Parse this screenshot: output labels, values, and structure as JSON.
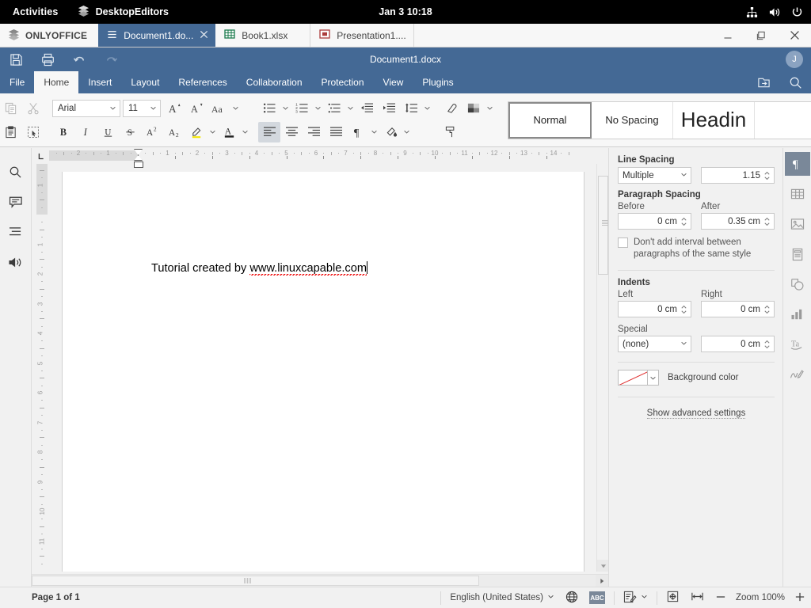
{
  "gnome": {
    "activities": "Activities",
    "app_name": "DesktopEditors",
    "app_icon": "desktopeditors-icon",
    "clock": "Jan 3  10:18",
    "tray": [
      "network-icon",
      "volume-icon",
      "power-icon"
    ]
  },
  "tabstrip": {
    "brand": "ONLYOFFICE",
    "brand_icon": "onlyoffice-logo-icon",
    "tabs": [
      {
        "label": "Document1.do...",
        "icon": "document-menu-icon",
        "active": true,
        "closable": true
      },
      {
        "label": "Book1.xlsx",
        "icon": "spreadsheet-icon",
        "active": false,
        "closable": false
      },
      {
        "label": "Presentation1....",
        "icon": "presentation-icon",
        "active": false,
        "closable": false
      }
    ],
    "window_controls": [
      "minimize-icon",
      "maximize-icon",
      "close-icon"
    ]
  },
  "header": {
    "title": "Document1.docx",
    "avatar_initial": "J",
    "quick_access": [
      "save-icon",
      "print-icon",
      "undo-icon",
      "redo-icon"
    ],
    "menu": [
      {
        "label": "File",
        "active": false
      },
      {
        "label": "Home",
        "active": true
      },
      {
        "label": "Insert",
        "active": false
      },
      {
        "label": "Layout",
        "active": false
      },
      {
        "label": "References",
        "active": false
      },
      {
        "label": "Collaboration",
        "active": false
      },
      {
        "label": "Protection",
        "active": false
      },
      {
        "label": "View",
        "active": false
      },
      {
        "label": "Plugins",
        "active": false
      }
    ],
    "right_icons": [
      "open-file-location-icon",
      "search-icon"
    ]
  },
  "ribbon": {
    "clipboard": [
      "copy-icon",
      "cut-icon",
      "paste-icon",
      "select-all-icon"
    ],
    "font_name": "Arial",
    "font_size": "11",
    "font_tools": [
      "increase-font-size-icon",
      "decrease-font-size-icon",
      "change-case-icon"
    ],
    "font_style_tools": [
      "bold-icon",
      "italic-icon",
      "underline-icon",
      "strikethrough-icon",
      "superscript-icon",
      "subscript-icon",
      "highlight-color-icon",
      "font-color-icon"
    ],
    "paragraph_tools_row1": [
      "bullets-icon",
      "numbering-icon",
      "multilevel-list-icon",
      "decrease-indent-icon",
      "increase-indent-icon",
      "line-spacing-icon"
    ],
    "paragraph_tools_row2": [
      "align-left-icon",
      "align-center-icon",
      "align-right-icon",
      "justify-icon",
      "nonprinting-characters-icon",
      "shading-icon"
    ],
    "extra_tools": [
      "clear-formatting-icon",
      "copy-style-icon",
      "paste-style-icon"
    ],
    "styles": [
      {
        "label": "Normal",
        "selected": true
      },
      {
        "label": "No Spacing",
        "selected": false
      },
      {
        "label": "Headin",
        "selected": false
      },
      {
        "label": "",
        "selected": false
      }
    ],
    "styles_more_icon": "chevron-down-icon"
  },
  "left_rail": {
    "items": [
      {
        "icon": "search-icon",
        "name": "search"
      },
      {
        "icon": "comments-icon",
        "name": "comments"
      },
      {
        "icon": "headings-navigation-icon",
        "name": "navigation"
      },
      {
        "icon": "text-to-speech-icon",
        "name": "text-to-speech"
      }
    ]
  },
  "ruler": {
    "horizontal_labels": [
      "2",
      "1",
      "1",
      "2",
      "3",
      "4",
      "5",
      "6",
      "7",
      "8",
      "9",
      "10",
      "11",
      "12",
      "13",
      "14"
    ],
    "vertical_labels": [
      "1",
      "1",
      "2",
      "3",
      "4",
      "5",
      "6",
      "7",
      "8",
      "9",
      "10",
      "11"
    ],
    "corner_icon": "tab-stop-left-icon"
  },
  "document": {
    "text_plain": "Tutorial created by ",
    "text_link": "www.linuxcapable.com",
    "link_misspelled": true
  },
  "right_panel": {
    "line_spacing": {
      "title": "Line Spacing",
      "mode": "Multiple",
      "value": "1.15"
    },
    "paragraph_spacing": {
      "title": "Paragraph Spacing",
      "before_label": "Before",
      "before_value": "0 cm",
      "after_label": "After",
      "after_value": "0.35 cm",
      "checkbox_label": "Don't add interval between paragraphs of the same style",
      "checkbox_checked": false
    },
    "indents": {
      "title": "Indents",
      "left_label": "Left",
      "left_value": "0 cm",
      "right_label": "Right",
      "right_value": "0 cm",
      "special_label": "Special",
      "special_value": "(none)",
      "special_by_value": "0 cm"
    },
    "background_color": {
      "label": "Background color",
      "swatch": "none",
      "swatch_slash_color": "#e03030"
    },
    "advanced_link": "Show advanced settings"
  },
  "right_rail": {
    "items": [
      {
        "icon": "paragraph-settings-icon",
        "name": "paragraph-settings",
        "active": true
      },
      {
        "icon": "table-settings-icon",
        "name": "table-settings",
        "active": false
      },
      {
        "icon": "image-settings-icon",
        "name": "image-settings",
        "active": false
      },
      {
        "icon": "header-footer-settings-icon",
        "name": "header-footer-settings",
        "active": false
      },
      {
        "icon": "shape-settings-icon",
        "name": "shape-settings",
        "active": false
      },
      {
        "icon": "chart-settings-icon",
        "name": "chart-settings",
        "active": false
      },
      {
        "icon": "text-art-settings-icon",
        "name": "text-art-settings",
        "active": false
      },
      {
        "icon": "signature-settings-icon",
        "name": "signature-settings",
        "active": false
      }
    ]
  },
  "statusbar": {
    "page_info": "Page 1 of 1",
    "language": "English (United States)",
    "language_caret": "chevron-down-icon",
    "globe_icon": "set-language-icon",
    "spellcheck_badge": "ABC",
    "spellcheck_icon": "spellcheck-icon",
    "track_changes_icon": "track-changes-icon",
    "fit_page_icon": "fit-to-page-icon",
    "fit_width_icon": "fit-to-width-icon",
    "zoom_out_icon": "zoom-out-icon",
    "zoom_label": "Zoom 100%",
    "zoom_in_icon": "zoom-in-icon"
  },
  "colors": {
    "accent_blue": "#446995",
    "gnome_black": "#000000",
    "panel_bg": "#f1f1f1",
    "page_white": "#ffffff",
    "spell_red": "#e00000",
    "active_rail": "#7a8899"
  }
}
